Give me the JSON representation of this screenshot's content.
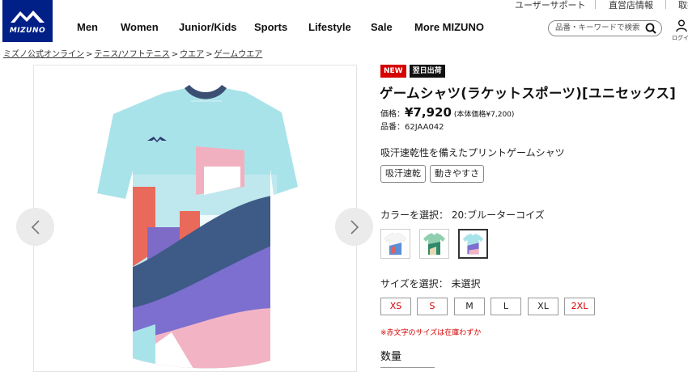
{
  "header": {
    "utility_links": [
      "ユーザーサポート",
      "直営店情報",
      "取扱"
    ],
    "logo_text": "MIZUNO",
    "nav": [
      "Men",
      "Women",
      "Junior/Kids",
      "Sports",
      "Lifestyle",
      "Sale",
      "More MIZUNO"
    ],
    "search_placeholder": "品番・キーワードで検索",
    "login_label": "ログイン"
  },
  "breadcrumb": [
    "ミズノ公式オンライン",
    "テニス/ソフトテニス",
    "ウエア",
    "ゲームウエア"
  ],
  "gallery": {
    "prev_icon": "chevron-left-icon",
    "next_icon": "chevron-right-icon"
  },
  "product": {
    "badges": [
      "NEW",
      "翌日出荷"
    ],
    "title": "ゲームシャツ(ラケットスポーツ)[ユニセックス]",
    "price_label": "価格：",
    "price": "¥7,920",
    "tax_note": "(本体価格¥7,200)",
    "sku": "品番：62JAA042",
    "description": "吸汗速乾性を備えたプリントゲームシャツ",
    "tags": [
      "吸汗速乾",
      "動きやすさ"
    ],
    "color_label": "カラーを選択： 20:ブルーターコイズ",
    "colors": [
      {
        "name": "white",
        "selected": false
      },
      {
        "name": "green",
        "selected": false
      },
      {
        "name": "blue-turquoise",
        "selected": true
      }
    ],
    "size_label": "サイズを選択：  未選択",
    "sizes": [
      {
        "label": "XS",
        "low_stock": true
      },
      {
        "label": "S",
        "low_stock": true
      },
      {
        "label": "M",
        "low_stock": false
      },
      {
        "label": "L",
        "low_stock": false
      },
      {
        "label": "XL",
        "low_stock": false
      },
      {
        "label": "2XL",
        "low_stock": true
      }
    ],
    "size_note": "※赤文字のサイズは在庫わずか",
    "quantity_label": "数量"
  },
  "colors": {
    "brand": "#001f87",
    "accent_red": "#d60000"
  }
}
